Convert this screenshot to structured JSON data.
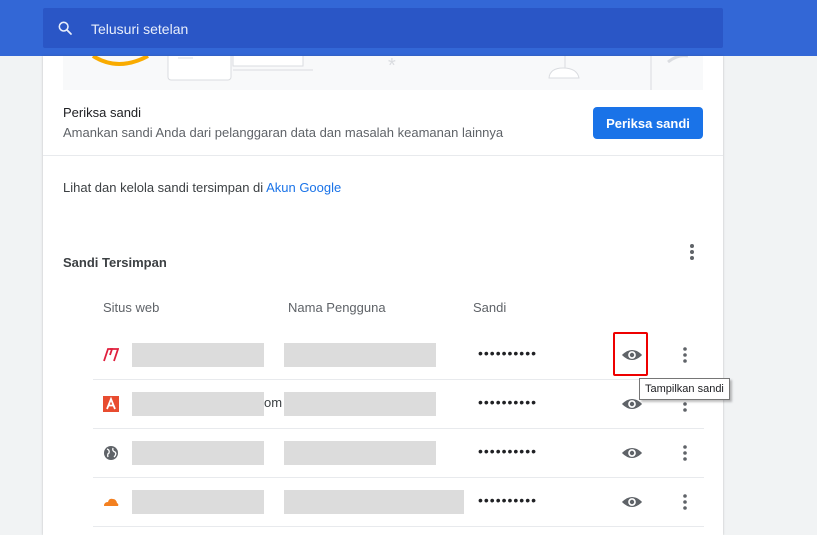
{
  "search": {
    "placeholder": "Telusuri setelan"
  },
  "check": {
    "title": "Periksa sandi",
    "description": "Amankan sandi Anda dari pelanggaran data dan masalah keamanan lainnya",
    "button_label": "Periksa sandi"
  },
  "manage": {
    "text": "Lihat dan kelola sandi tersimpan di ",
    "link": "Akun Google"
  },
  "saved": {
    "title": "Sandi Tersimpan",
    "columns": {
      "site": "Situs web",
      "username": "Nama Pengguna",
      "password": "Sandi"
    },
    "rows": [
      {
        "favicon": "adobe-icon",
        "site_suffix": "",
        "password": "••••••••••"
      },
      {
        "favicon": "autodesk-icon",
        "site_suffix": "om",
        "password": "••••••••••"
      },
      {
        "favicon": "globe-icon",
        "site_suffix": "",
        "password": "••••••••••"
      },
      {
        "favicon": "cloudflare-icon",
        "site_suffix": "",
        "password": "••••••••••"
      }
    ]
  },
  "tooltip": {
    "text": "Tampilkan sandi"
  },
  "colors": {
    "header": "#3367d6",
    "search_bg": "#2a56c6",
    "primary": "#1a73e8",
    "highlight": "#e00000"
  }
}
